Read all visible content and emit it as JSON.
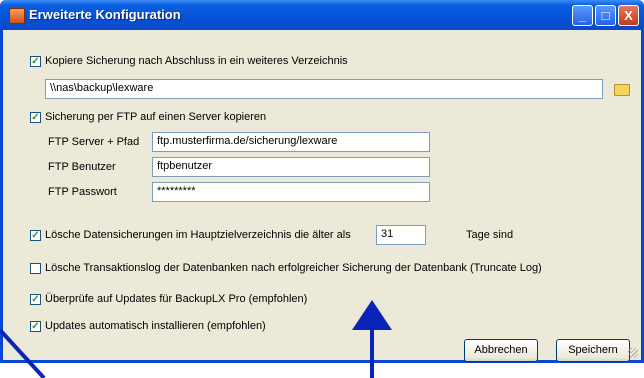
{
  "window": {
    "title": "Erweiterte Konfiguration",
    "minimize_glyph": "_",
    "maximize_glyph": "□",
    "close_glyph": "X"
  },
  "copy_backup": {
    "checked": true,
    "label": "Kopiere Sicherung nach Abschluss in ein weiteres Verzeichnis",
    "path_value": "\\\\nas\\backup\\lexware",
    "browse_icon": "folder-icon"
  },
  "ftp": {
    "checked": true,
    "label": "Sicherung per FTP auf einen Server kopieren",
    "server_label": "FTP Server + Pfad",
    "server_value": "ftp.musterfirma.de/sicherung/lexware",
    "user_label": "FTP Benutzer",
    "user_value": "ftpbenutzer",
    "password_label": "FTP Passwort",
    "password_value": "*********"
  },
  "delete_old": {
    "checked": true,
    "label_prefix": "Lösche Datensicherungen im Hauptzielverzeichnis die älter als",
    "days_value": "31",
    "label_suffix": "Tage sind"
  },
  "truncate_log": {
    "checked": false,
    "label": "Lösche Transaktionslog der Datenbanken nach erfolgreicher Sicherung der Datenbank (Truncate Log)"
  },
  "check_updates": {
    "checked": true,
    "label": "Überprüfe auf Updates für BackupLX Pro (empfohlen)"
  },
  "auto_install": {
    "checked": true,
    "label": "Updates automatisch installieren (empfohlen)"
  },
  "buttons": {
    "cancel_label": "Abbrechen",
    "save_label": "Speichern"
  },
  "colors": {
    "titlebar": "#0652d9",
    "dialog_bg": "#ece9d8",
    "arrow": "#0a24b8"
  }
}
